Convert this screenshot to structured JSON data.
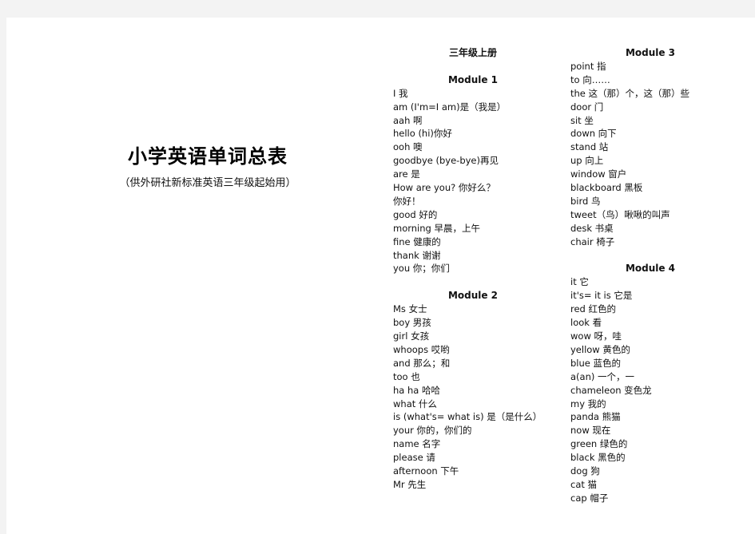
{
  "document": {
    "title": "小学英语单词总表",
    "subtitle": "（供外研社新标准英语三年级起始用）",
    "volume_heading": "三年级上册",
    "modules": [
      {
        "heading": "Module 1",
        "entries": [
          "I 我",
          "am (I'm=I am)是（我是）",
          "aah 啊",
          "hello (hi)你好",
          "ooh 噢",
          "goodbye (bye-bye)再见",
          "are 是",
          "How are you?  你好么？",
          "你好！",
          "good 好的",
          "morning 早晨，上午",
          "fine 健康的",
          "thank 谢谢",
          "you 你；你们"
        ]
      },
      {
        "heading": "Module 2",
        "entries": [
          "Ms 女士",
          "boy 男孩",
          "girl 女孩",
          "whoops 哎哟",
          "and 那么；和",
          "too 也",
          "ha ha 哈哈",
          "what 什么",
          "is (what's= what is)  是（是什么）",
          "your 你的，你们的",
          "name 名字",
          "please 请",
          "afternoon 下午",
          "Mr 先生"
        ]
      },
      {
        "heading": "Module 3",
        "entries": [
          "point 指",
          "to 向……",
          "the 这（那）个，这（那）些",
          "door 门",
          "sit 坐",
          "down 向下",
          "stand 站",
          "up 向上",
          "window 窗户",
          "blackboard 黑板",
          "bird 鸟",
          "tweet（鸟）啾啾的叫声",
          "desk 书桌",
          "chair 椅子"
        ]
      },
      {
        "heading": "Module 4",
        "entries": [
          "it 它",
          "it's= it is 它是",
          "red 红色的",
          "look 看",
          "wow 呀，哇",
          "yellow 黄色的",
          "blue 蓝色的",
          "a(an) 一个，一",
          "chameleon 变色龙",
          "my 我的",
          "panda 熊猫",
          "now 现在",
          "green 绿色的",
          "black 黑色的",
          "dog 狗",
          "cat 猫",
          "cap 帽子"
        ]
      }
    ]
  }
}
